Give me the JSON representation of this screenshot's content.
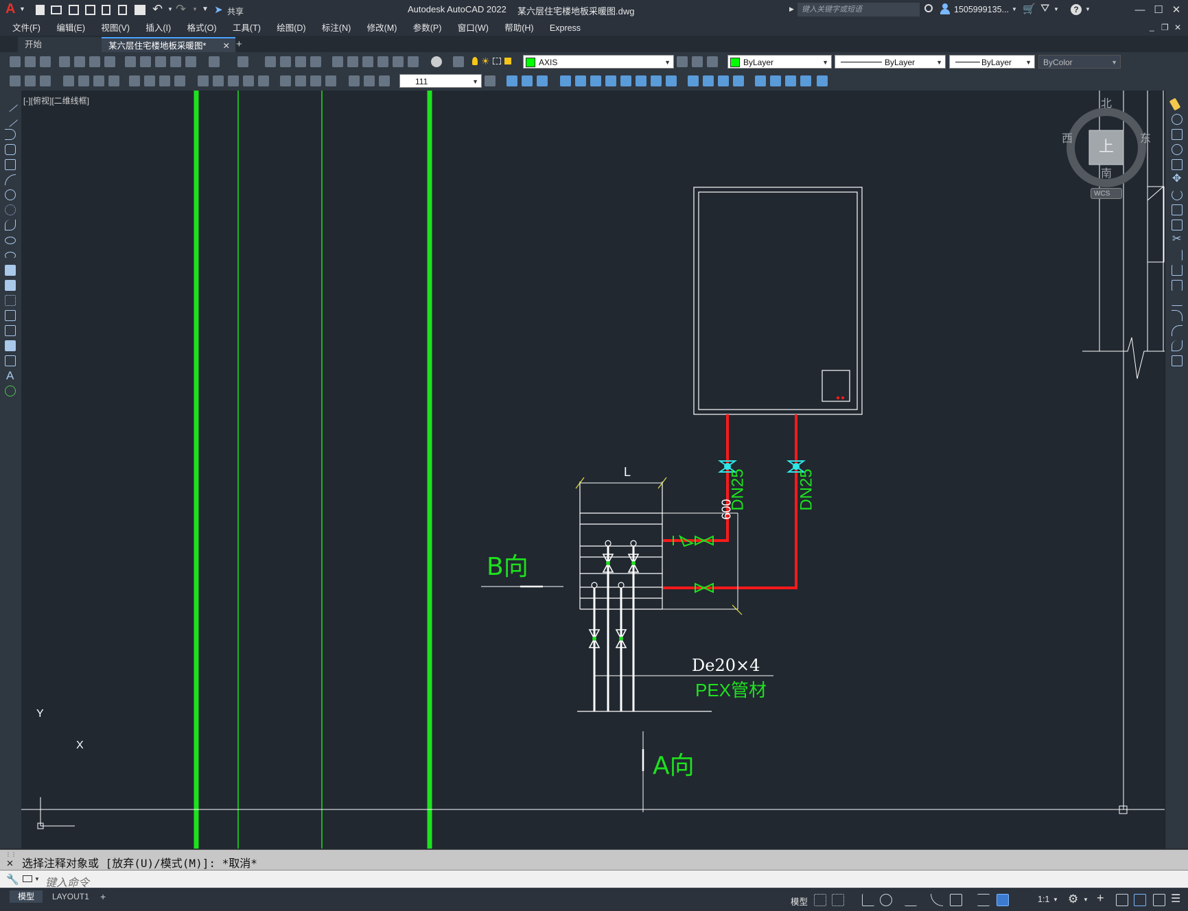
{
  "app": {
    "logo": "A",
    "title": "Autodesk AutoCAD 2022",
    "filename": "某六层住宅楼地板采暖图.dwg",
    "search_placeholder": "键入关键字或短语",
    "user": "1505999135...",
    "share": "共享"
  },
  "menu": [
    "文件(F)",
    "编辑(E)",
    "视图(V)",
    "插入(I)",
    "格式(O)",
    "工具(T)",
    "绘图(D)",
    "标注(N)",
    "修改(M)",
    "参数(P)",
    "窗口(W)",
    "帮助(H)",
    "Express"
  ],
  "tabs": {
    "start": "开始",
    "drawing": "某六层住宅楼地板采暖图*",
    "add": "+"
  },
  "toolbar": {
    "layer": "AXIS",
    "color": "ByLayer",
    "linetype": "ByLayer",
    "lineweight": "ByLayer",
    "plotstyle": "ByColor",
    "dimstyle": "111"
  },
  "viewport": {
    "label": "[-][俯视][二维线框]"
  },
  "viewcube": {
    "north": "北",
    "south": "南",
    "east": "东",
    "west": "西",
    "top": "上",
    "wcs": "WCS"
  },
  "ucs": {
    "x": "X",
    "y": "Y"
  },
  "drawing": {
    "b_direction": "B向",
    "a_direction": "A向",
    "dn_left": "DN25",
    "dn_right": "DN25",
    "dim_l": "L",
    "dim_600": "600",
    "pipe_spec": "De20×4",
    "pipe_material": "PEX管材"
  },
  "command": {
    "history": "选择注释对象或 [放弃(U)/模式(M)]: *取消*",
    "placeholder": "键入命令"
  },
  "layout_tabs": [
    "模型",
    "LAYOUT1",
    "+"
  ],
  "status": {
    "model": "模型",
    "scale": "1:1"
  },
  "colors": {
    "green": "#1ee21e",
    "red": "#ff1a1a",
    "cyan": "#2fe6e6",
    "white": "#ffffff",
    "bg": "#212830"
  }
}
